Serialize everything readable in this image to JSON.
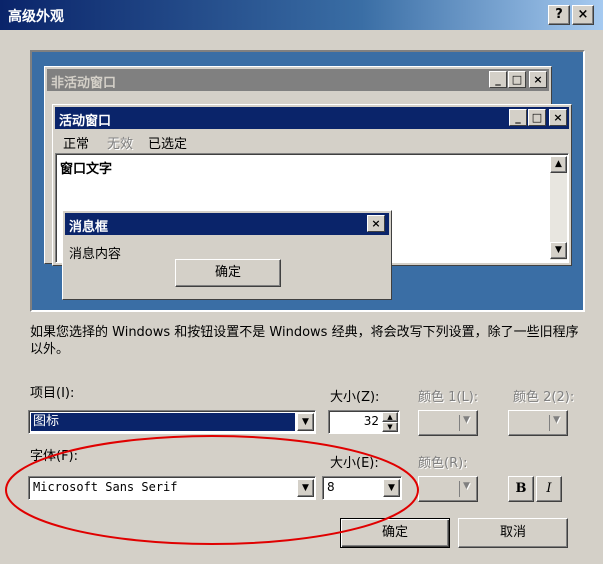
{
  "window": {
    "title": "高级外观",
    "help_btn": "?",
    "close_btn": "×"
  },
  "preview": {
    "inactive_title": "非活动窗口",
    "active_title": "活动窗口",
    "menu_normal": "正常",
    "menu_disabled": "无效",
    "menu_selected": "已选定",
    "window_text": "窗口文字",
    "msgbox_title": "消息框",
    "msgbox_text": "消息内容",
    "msgbox_ok": "确定",
    "min_glyph": "_",
    "max_glyph": "□",
    "close_glyph": "×"
  },
  "description": "如果您选择的 Windows 和按钮设置不是 Windows 经典，将会改写下列设置，除了一些旧程序以外。",
  "item": {
    "label": "项目(I):",
    "value": "图标",
    "size_label": "大小(Z):",
    "size_value": "32",
    "color1_label": "颜色 1(L):",
    "color2_label": "颜色 2(2):"
  },
  "font": {
    "label": "字体(F):",
    "value": "Microsoft Sans Serif",
    "size_label": "大小(E):",
    "size_value": "8",
    "color_label": "颜色(R):",
    "bold": "B",
    "italic": "I"
  },
  "buttons": {
    "ok": "确定",
    "cancel": "取消"
  },
  "colors": {
    "titlebar_active": "#0a246a",
    "desktop": "#3a6ea5",
    "annotation": "#e00000"
  }
}
